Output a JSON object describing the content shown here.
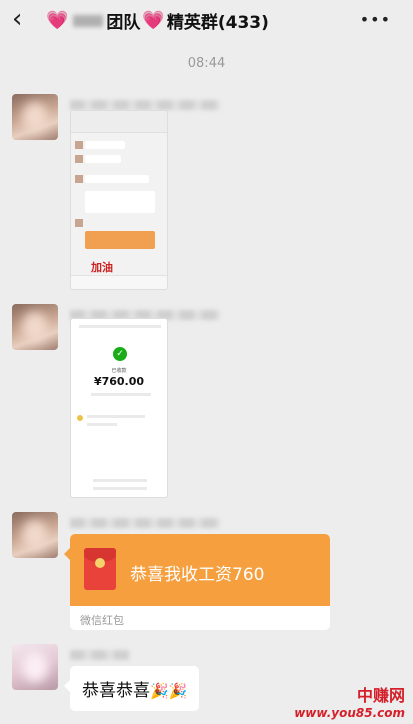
{
  "header": {
    "back_icon": "chevron-left-icon",
    "title_suffix": "团队",
    "title_main": "精英群(433)",
    "more_icon": "more-dots-icon"
  },
  "chat": {
    "timestamp": "08:44",
    "screenshot1": {
      "red_text": "加油"
    },
    "screenshot2": {
      "amount": "¥760.00",
      "status": "已收款"
    },
    "red_packet": {
      "message": "恭喜我收工资760",
      "footer": "微信红包"
    },
    "text_message": {
      "text": "恭喜恭喜",
      "emoji": "🎉🎉"
    }
  },
  "watermark": {
    "name": "中赚网",
    "url": "www.you85.com"
  },
  "colors": {
    "background": "#ededed",
    "red_packet": "#f59f3f",
    "check_green": "#1aad19",
    "watermark_red": "#d4202a"
  }
}
